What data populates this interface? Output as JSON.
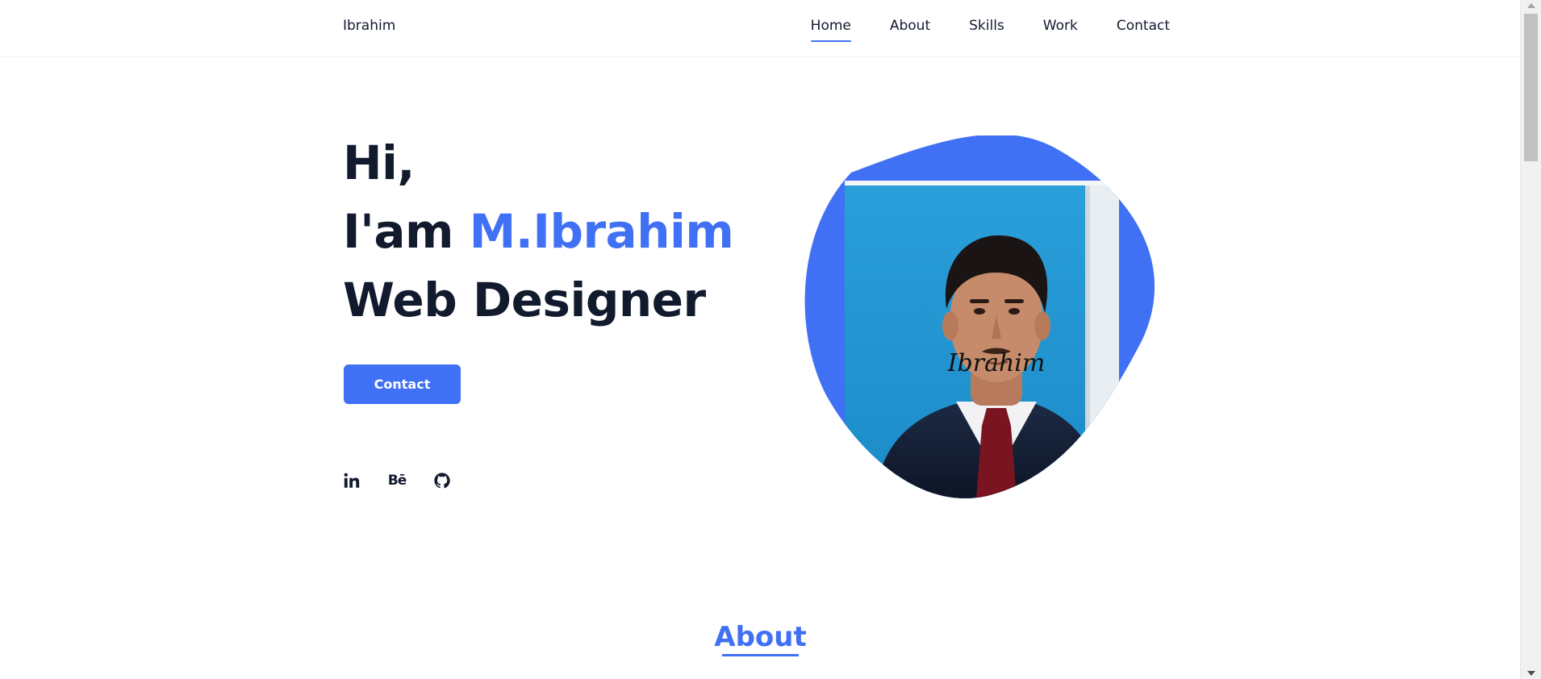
{
  "header": {
    "logo": "Ibrahim",
    "nav": [
      {
        "label": "Home",
        "active": true
      },
      {
        "label": "About",
        "active": false
      },
      {
        "label": "Skills",
        "active": false
      },
      {
        "label": "Work",
        "active": false
      },
      {
        "label": "Contact",
        "active": false
      }
    ]
  },
  "hero": {
    "greeting": "Hi,",
    "intro_prefix": "I'am ",
    "name": "M.Ibrahim",
    "role": "Web Designer",
    "button_label": "Contact",
    "photo_signature": "Ibrahim",
    "socials": [
      {
        "icon": "linkedin-icon",
        "text": "in"
      },
      {
        "icon": "behance-icon",
        "text": "Bē"
      },
      {
        "icon": "github-icon",
        "text": ""
      }
    ]
  },
  "about": {
    "title": "About"
  },
  "colors": {
    "accent": "#4070f4",
    "text_dark": "#121a2e"
  }
}
